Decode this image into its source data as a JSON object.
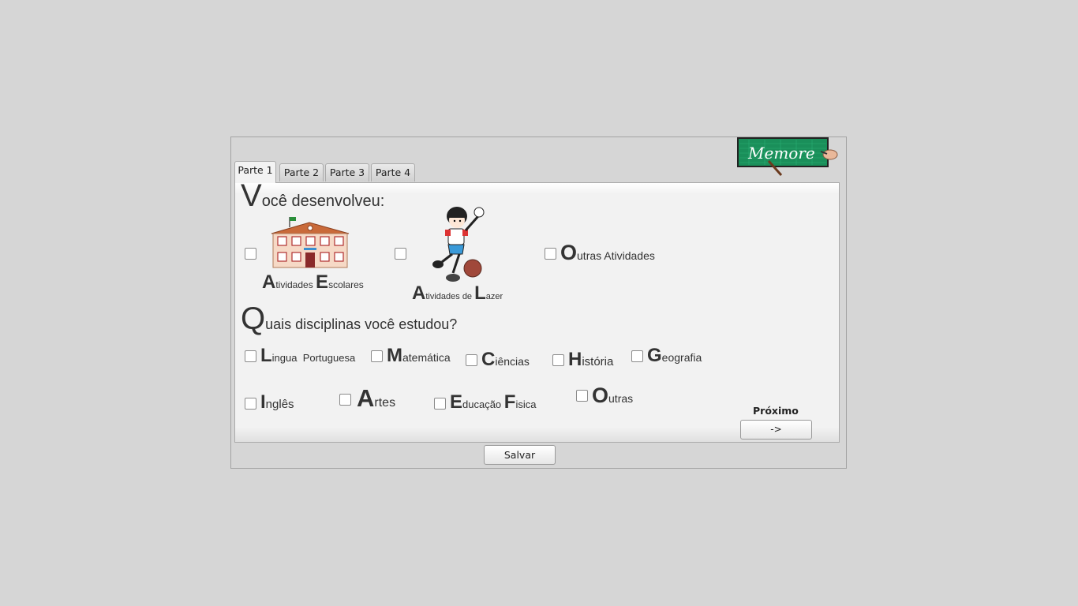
{
  "logo": {
    "text": "Memore"
  },
  "tabs": [
    {
      "label": "Parte 1",
      "active": true
    },
    {
      "label": "Parte 2"
    },
    {
      "label": "Parte 3"
    },
    {
      "label": "Parte 4"
    }
  ],
  "section1": {
    "heading_cap": "V",
    "heading_rest": "ocê desenvolveu:",
    "options": [
      {
        "cap1": "A",
        "rest1": "tividades ",
        "cap2": "E",
        "rest2": "scolares",
        "checked": false
      },
      {
        "cap1": "A",
        "rest1": "tividades de ",
        "cap2": "L",
        "rest2": "azer",
        "checked": false
      },
      {
        "cap1": "O",
        "rest1": "utras Atividades",
        "checked": false
      }
    ]
  },
  "section2": {
    "heading_cap": "Q",
    "heading_rest": "uais disciplinas você estudou?",
    "subjects": [
      {
        "cap": "L",
        "rest": "ingua  Portuguesa"
      },
      {
        "cap": "M",
        "rest": "atemática"
      },
      {
        "cap": "C",
        "rest": "iências"
      },
      {
        "cap": "H",
        "rest": "istória"
      },
      {
        "cap": "G",
        "rest": "eografia"
      },
      {
        "cap": "I",
        "rest": "nglês"
      },
      {
        "cap": "A",
        "rest": "rtes"
      },
      {
        "cap": "E",
        "rest": "ducação ",
        "cap2": "F",
        "rest2": "isica"
      },
      {
        "cap": "O",
        "rest": "utras"
      }
    ]
  },
  "next": {
    "label": "Próximo",
    "button": "->"
  },
  "save": {
    "label": "Salvar"
  },
  "colors": {
    "background": "#d6d6d6",
    "panel": "#f2f2f2",
    "logo_board": "#1a8f5a"
  },
  "icons": [
    "school-building-icon",
    "boy-playing-ball-icon",
    "memore-logo-icon"
  ]
}
